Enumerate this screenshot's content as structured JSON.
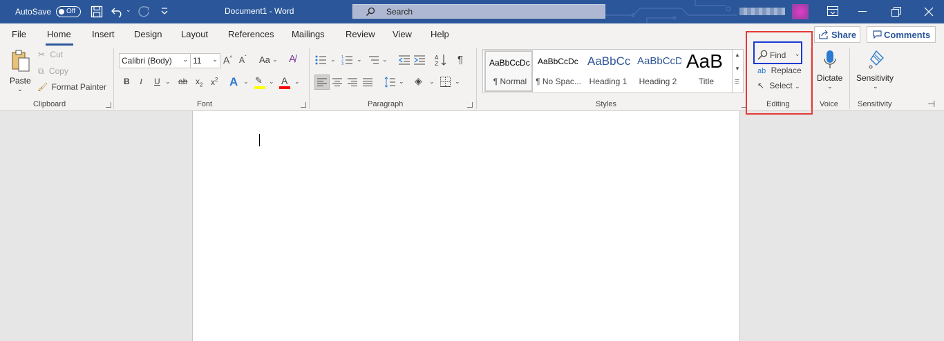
{
  "titlebar": {
    "autosave_label": "AutoSave",
    "autosave_state": "Off",
    "doc_title": "Document1  -  Word",
    "search_placeholder": "Search"
  },
  "tabs": [
    "File",
    "Home",
    "Insert",
    "Design",
    "Layout",
    "References",
    "Mailings",
    "Review",
    "View",
    "Help"
  ],
  "active_tab": "Home",
  "share_label": "Share",
  "comments_label": "Comments",
  "clipboard": {
    "paste": "Paste",
    "cut": "Cut",
    "copy": "Copy",
    "format_painter": "Format Painter",
    "group": "Clipboard"
  },
  "font": {
    "font_name": "Calibri (Body)",
    "font_size": "11",
    "change_case": "Aa",
    "group": "Font"
  },
  "paragraph": {
    "group": "Paragraph"
  },
  "styles": {
    "items": [
      {
        "preview": "AaBbCcDc",
        "name": "¶ Normal"
      },
      {
        "preview": "AaBbCcDc",
        "name": "¶ No Spac..."
      },
      {
        "preview": "AaBbCc",
        "name": "Heading 1"
      },
      {
        "preview": "AaBbCcD",
        "name": "Heading 2"
      },
      {
        "preview": "AaB",
        "name": "Title"
      }
    ],
    "group": "Styles"
  },
  "editing": {
    "find": "Find",
    "replace": "Replace",
    "select": "Select",
    "group": "Editing"
  },
  "voice": {
    "dictate": "Dictate",
    "group": "Voice"
  },
  "sensitivity": {
    "label": "Sensitivity",
    "group": "Sensitivity"
  },
  "colors": {
    "brand": "#2b579a",
    "highlight_yellow": "#ffff00",
    "font_red": "#ff0000",
    "annotation_red": "#e53935",
    "annotation_blue": "#1a39d3"
  }
}
